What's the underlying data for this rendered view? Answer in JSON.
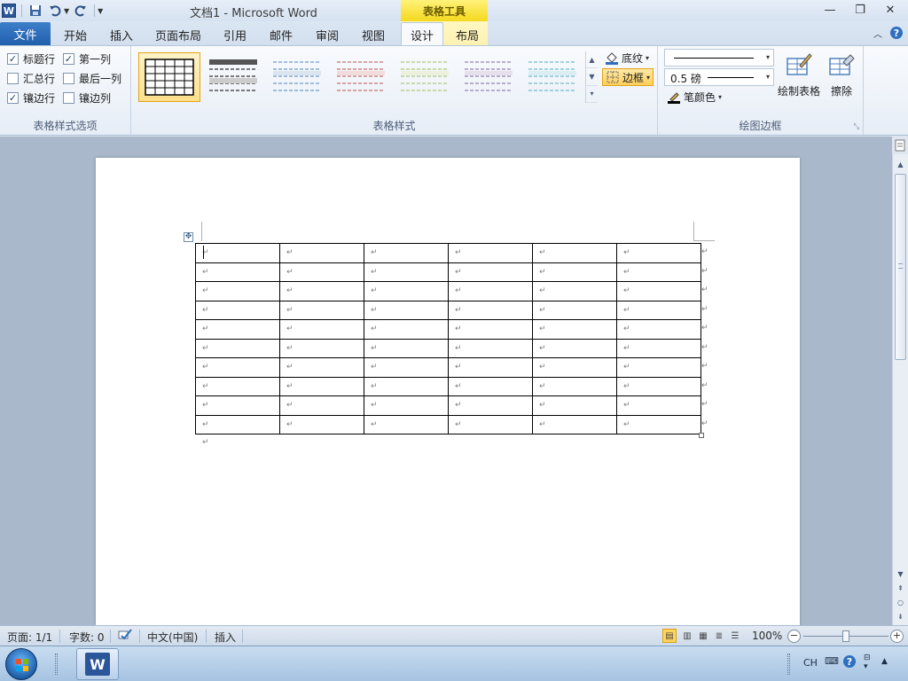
{
  "titlebar": {
    "doc_title": "文档1 - Microsoft Word",
    "context_group": "表格工具",
    "qat": [
      "save-icon",
      "undo-icon",
      "redo-icon",
      "customize-icon"
    ],
    "window_controls": [
      "minimize-icon",
      "restore-icon",
      "close-icon"
    ]
  },
  "tabs": {
    "file": "文件",
    "items": [
      "开始",
      "插入",
      "页面布局",
      "引用",
      "邮件",
      "审阅",
      "视图",
      "设计",
      "布局"
    ],
    "active": "设计"
  },
  "ribbon": {
    "table_style_options": {
      "label": "表格样式选项",
      "options": [
        {
          "label": "标题行",
          "checked": true
        },
        {
          "label": "第一列",
          "checked": true
        },
        {
          "label": "汇总行",
          "checked": false
        },
        {
          "label": "最后一列",
          "checked": false
        },
        {
          "label": "镶边行",
          "checked": true
        },
        {
          "label": "镶边列",
          "checked": false
        }
      ]
    },
    "table_styles": {
      "label": "表格样式",
      "shading": "底纹",
      "borders": "边框",
      "style_colors": [
        "#000000",
        "#000000",
        "#4f81bd",
        "#c0504d",
        "#9bbb59",
        "#8064a2",
        "#4bacc6"
      ]
    },
    "draw_borders": {
      "label": "绘图边框",
      "line_weight": "0.5 磅",
      "pen_color": "笔颜色",
      "draw_table": "绘制表格",
      "eraser": "擦除"
    }
  },
  "document": {
    "table": {
      "rows": 10,
      "cols": 6
    },
    "cell_mark": "↵"
  },
  "statusbar": {
    "page": "页面: 1/1",
    "words": "字数: 0",
    "language": "中文(中国)",
    "mode": "插入",
    "zoom": "100%",
    "zoom_level_percent": 100
  },
  "taskbar": {
    "lang": "CH"
  }
}
